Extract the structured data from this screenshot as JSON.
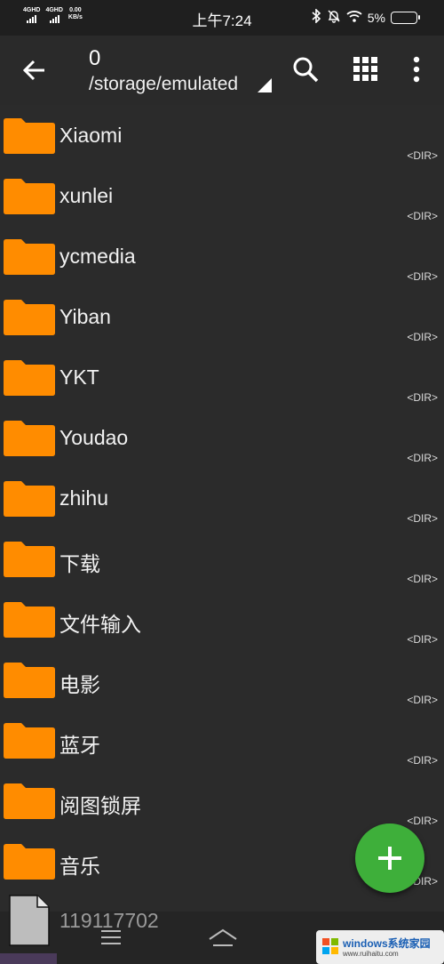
{
  "status_bar": {
    "net1": "4GHD",
    "net2": "4GHD",
    "speed_value": "0.00",
    "speed_unit": "KB/s",
    "time": "上午7:24",
    "battery": "5%"
  },
  "toolbar": {
    "title": "0",
    "path": "/storage/emulated"
  },
  "files": [
    {
      "name": "Xiaomi",
      "type": "<DIR>"
    },
    {
      "name": "xunlei",
      "type": "<DIR>"
    },
    {
      "name": "ycmedia",
      "type": "<DIR>"
    },
    {
      "name": "Yiban",
      "type": "<DIR>"
    },
    {
      "name": "YKT",
      "type": "<DIR>"
    },
    {
      "name": "Youdao",
      "type": "<DIR>"
    },
    {
      "name": "zhihu",
      "type": "<DIR>"
    },
    {
      "name": "下载",
      "type": "<DIR>"
    },
    {
      "name": "文件输入",
      "type": "<DIR>"
    },
    {
      "name": "电影",
      "type": "<DIR>"
    },
    {
      "name": "蓝牙",
      "type": "<DIR>"
    },
    {
      "name": "阅图锁屏",
      "type": "<DIR>"
    },
    {
      "name": "音乐",
      "type": "<DIR>"
    }
  ],
  "bottom_file": {
    "name": "119117702"
  },
  "watermark": {
    "title": "windows系统家园",
    "url": "www.ruihaitu.com"
  },
  "colors": {
    "folder": "#ff8c00",
    "fab": "#3eaf3a",
    "background": "#2b2b2b"
  }
}
